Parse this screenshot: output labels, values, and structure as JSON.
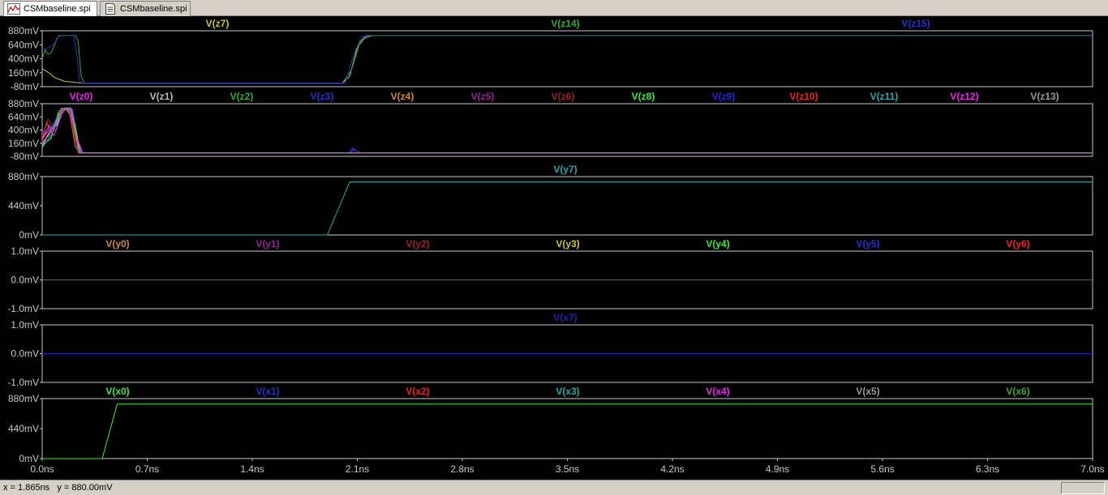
{
  "tabs": [
    {
      "label": "CSMbaseline.spi",
      "icon": "waveform-icon",
      "active": true
    },
    {
      "label": "CSMbaseline.spi",
      "icon": "netlist-document-icon",
      "active": false
    }
  ],
  "status": {
    "x_readout": "x = 1.865ns",
    "y_readout": "y = 880.00mV"
  },
  "colors": {
    "background": "#000000",
    "frame": "#c8c8c8",
    "axis_text": "#c8c8c8"
  },
  "chart_data": [
    {
      "type": "line",
      "y_tick_labels": [
        "880mV",
        "640mV",
        "400mV",
        "160mV",
        "-80mV"
      ],
      "y_tick_values": [
        880,
        640,
        400,
        160,
        -80
      ],
      "ylim": [
        -80,
        880
      ],
      "xlim": [
        0,
        7.0
      ],
      "series": [
        {
          "name": "V(z7)",
          "color": "#c8c832",
          "points": [
            [
              0,
              230
            ],
            [
              0.02,
              200
            ],
            [
              0.05,
              150
            ],
            [
              0.08,
              80
            ],
            [
              0.12,
              40
            ],
            [
              0.15,
              10
            ],
            [
              0.2,
              0
            ],
            [
              0.27,
              -20
            ],
            [
              2.0,
              -20
            ],
            [
              2.05,
              100
            ],
            [
              2.1,
              600
            ],
            [
              2.15,
              760
            ],
            [
              2.2,
              800
            ],
            [
              7.0,
              800
            ]
          ]
        },
        {
          "name": "V(z14)",
          "color": "#33aa33",
          "points": [
            [
              0,
              400
            ],
            [
              0.02,
              550
            ],
            [
              0.04,
              480
            ],
            [
              0.06,
              500
            ],
            [
              0.08,
              620
            ],
            [
              0.1,
              760
            ],
            [
              0.12,
              800
            ],
            [
              0.22,
              800
            ],
            [
              0.24,
              700
            ],
            [
              0.26,
              100
            ],
            [
              0.28,
              -20
            ],
            [
              2.0,
              -20
            ],
            [
              2.06,
              200
            ],
            [
              2.12,
              700
            ],
            [
              2.16,
              800
            ],
            [
              7.0,
              800
            ]
          ]
        },
        {
          "name": "V(z15)",
          "color": "#2233cc",
          "points": [
            [
              0,
              550
            ],
            [
              0.05,
              600
            ],
            [
              0.09,
              680
            ],
            [
              0.11,
              800
            ],
            [
              0.21,
              800
            ],
            [
              0.23,
              500
            ],
            [
              0.25,
              0
            ],
            [
              0.27,
              -20
            ],
            [
              2.02,
              -20
            ],
            [
              2.08,
              500
            ],
            [
              2.13,
              780
            ],
            [
              2.17,
              800
            ],
            [
              7.0,
              800
            ]
          ]
        }
      ]
    },
    {
      "type": "line",
      "y_tick_labels": [
        "880mV",
        "640mV",
        "400mV",
        "160mV",
        "-80mV"
      ],
      "y_tick_values": [
        880,
        640,
        400,
        160,
        -80
      ],
      "ylim": [
        -80,
        880
      ],
      "xlim": [
        0,
        7.0
      ],
      "series": [
        {
          "name": "V(z0)",
          "color": "#ee22ee",
          "points": [
            [
              0,
              200
            ],
            [
              0.04,
              450
            ],
            [
              0.08,
              300
            ],
            [
              0.12,
              650
            ],
            [
              0.16,
              800
            ],
            [
              0.2,
              780
            ],
            [
              0.24,
              200
            ],
            [
              0.27,
              -20
            ],
            [
              7.0,
              -20
            ]
          ]
        },
        {
          "name": "V(z1)",
          "color": "#bbbbbb",
          "points": [
            [
              0,
              100
            ],
            [
              0.05,
              350
            ],
            [
              0.1,
              500
            ],
            [
              0.14,
              800
            ],
            [
              0.19,
              800
            ],
            [
              0.23,
              300
            ],
            [
              0.26,
              -20
            ],
            [
              7.0,
              -20
            ]
          ]
        },
        {
          "name": "V(z2)",
          "color": "#33aa33",
          "points": [
            [
              0,
              300
            ],
            [
              0.03,
              500
            ],
            [
              0.07,
              400
            ],
            [
              0.11,
              750
            ],
            [
              0.17,
              800
            ],
            [
              0.21,
              400
            ],
            [
              0.25,
              -20
            ],
            [
              7.0,
              -20
            ]
          ]
        },
        {
          "name": "V(z3)",
          "color": "#2233cc",
          "points": [
            [
              0,
              150
            ],
            [
              0.06,
              420
            ],
            [
              0.1,
              650
            ],
            [
              0.15,
              800
            ],
            [
              0.2,
              700
            ],
            [
              0.24,
              -20
            ],
            [
              2.04,
              -20
            ],
            [
              2.07,
              60
            ],
            [
              2.1,
              10
            ],
            [
              2.13,
              -20
            ],
            [
              7.0,
              -20
            ]
          ]
        },
        {
          "name": "V(z4)",
          "color": "#cc8833",
          "points": [
            [
              0,
              250
            ],
            [
              0.04,
              380
            ],
            [
              0.09,
              550
            ],
            [
              0.13,
              800
            ],
            [
              0.18,
              760
            ],
            [
              0.22,
              100
            ],
            [
              0.25,
              -20
            ],
            [
              7.0,
              -20
            ]
          ]
        },
        {
          "name": "V(z5)",
          "color": "#992299",
          "points": [
            [
              0,
              180
            ],
            [
              0.05,
              300
            ],
            [
              0.1,
              600
            ],
            [
              0.15,
              800
            ],
            [
              0.21,
              600
            ],
            [
              0.24,
              -20
            ],
            [
              2.05,
              -20
            ],
            [
              2.08,
              40
            ],
            [
              2.12,
              -20
            ],
            [
              7.0,
              -20
            ]
          ]
        },
        {
          "name": "V(z6)",
          "color": "#992222",
          "points": [
            [
              0,
              300
            ],
            [
              0.04,
              600
            ],
            [
              0.08,
              450
            ],
            [
              0.13,
              780
            ],
            [
              0.18,
              800
            ],
            [
              0.22,
              200
            ],
            [
              0.26,
              -20
            ],
            [
              7.0,
              -20
            ]
          ]
        },
        {
          "name": "V(z8)",
          "color": "#33ee33",
          "points": [
            [
              0,
              120
            ],
            [
              0.06,
              250
            ],
            [
              0.11,
              700
            ],
            [
              0.16,
              800
            ],
            [
              0.22,
              500
            ],
            [
              0.25,
              -20
            ],
            [
              7.0,
              -20
            ]
          ]
        },
        {
          "name": "V(z9)",
          "color": "#2222ee",
          "points": [
            [
              0,
              350
            ],
            [
              0.05,
              420
            ],
            [
              0.1,
              550
            ],
            [
              0.14,
              800
            ],
            [
              0.19,
              780
            ],
            [
              0.23,
              150
            ],
            [
              0.26,
              -20
            ],
            [
              2.04,
              -20
            ],
            [
              2.07,
              80
            ],
            [
              2.11,
              -20
            ],
            [
              7.0,
              -20
            ]
          ]
        },
        {
          "name": "V(z10)",
          "color": "#ee2222",
          "points": [
            [
              0,
              200
            ],
            [
              0.03,
              550
            ],
            [
              0.07,
              350
            ],
            [
              0.12,
              700
            ],
            [
              0.17,
              800
            ],
            [
              0.21,
              450
            ],
            [
              0.24,
              -20
            ],
            [
              7.0,
              -20
            ]
          ]
        },
        {
          "name": "V(z11)",
          "color": "#22aaaa",
          "points": [
            [
              0,
              80
            ],
            [
              0.06,
              300
            ],
            [
              0.11,
              600
            ],
            [
              0.15,
              800
            ],
            [
              0.2,
              750
            ],
            [
              0.24,
              50
            ],
            [
              0.27,
              -20
            ],
            [
              7.0,
              -20
            ]
          ]
        },
        {
          "name": "V(z12)",
          "color": "#ee22ee",
          "points": [
            [
              0,
              260
            ],
            [
              0.05,
              480
            ],
            [
              0.09,
              380
            ],
            [
              0.14,
              760
            ],
            [
              0.18,
              800
            ],
            [
              0.23,
              250
            ],
            [
              0.27,
              -20
            ],
            [
              7.0,
              -20
            ]
          ]
        },
        {
          "name": "V(z13)",
          "color": "#999999",
          "points": [
            [
              0,
              140
            ],
            [
              0.04,
              320
            ],
            [
              0.09,
              520
            ],
            [
              0.13,
              780
            ],
            [
              0.19,
              800
            ],
            [
              0.22,
              350
            ],
            [
              0.25,
              -20
            ],
            [
              7.0,
              -20
            ]
          ]
        }
      ]
    },
    {
      "type": "line",
      "y_tick_labels": [
        "880mV",
        "440mV",
        "0mV"
      ],
      "y_tick_values": [
        880,
        440,
        0
      ],
      "ylim": [
        0,
        880
      ],
      "xlim": [
        0,
        7.0
      ],
      "series": [
        {
          "name": "V(y7)",
          "color": "#22aaaa",
          "points": [
            [
              0,
              0
            ],
            [
              1.9,
              0
            ],
            [
              2.05,
              800
            ],
            [
              7.0,
              800
            ]
          ]
        }
      ]
    },
    {
      "type": "line",
      "y_tick_labels": [
        "1.0mV",
        "0.0mV",
        "-1.0mV"
      ],
      "y_tick_values": [
        1,
        0,
        -1
      ],
      "ylim": [
        -1,
        1
      ],
      "xlim": [
        0,
        7.0
      ],
      "series": [
        {
          "name": "V(y0)",
          "color": "#cc8833",
          "points": [
            [
              0,
              0
            ],
            [
              7.0,
              0
            ]
          ]
        },
        {
          "name": "V(y1)",
          "color": "#992299",
          "points": [
            [
              0,
              0
            ],
            [
              7.0,
              0
            ]
          ]
        },
        {
          "name": "V(y2)",
          "color": "#992222",
          "points": [
            [
              0,
              0
            ],
            [
              7.0,
              0
            ]
          ]
        },
        {
          "name": "V(y3)",
          "color": "#c8c832",
          "points": [
            [
              0,
              0
            ],
            [
              7.0,
              0
            ]
          ]
        },
        {
          "name": "V(y4)",
          "color": "#33ee33",
          "points": [
            [
              0,
              0
            ],
            [
              7.0,
              0
            ]
          ]
        },
        {
          "name": "V(y5)",
          "color": "#2233cc",
          "points": [
            [
              0,
              0
            ],
            [
              7.0,
              0
            ]
          ]
        },
        {
          "name": "V(y6)",
          "color": "#ee2222",
          "points": [
            [
              0,
              0
            ],
            [
              7.0,
              0
            ]
          ]
        }
      ]
    },
    {
      "type": "line",
      "y_tick_labels": [
        "1.0mV",
        "0.0mV",
        "-1.0mV"
      ],
      "y_tick_values": [
        1,
        0,
        -1
      ],
      "ylim": [
        -1,
        1
      ],
      "xlim": [
        0,
        7.0
      ],
      "series": [
        {
          "name": "V(x7)",
          "color": "#2222aa",
          "points": [
            [
              0,
              0
            ],
            [
              7.0,
              0
            ]
          ]
        }
      ]
    },
    {
      "type": "line",
      "y_tick_labels": [
        "880mV",
        "440mV",
        "0mV"
      ],
      "y_tick_values": [
        880,
        440,
        0
      ],
      "ylim": [
        0,
        880
      ],
      "xlim": [
        0,
        7.0
      ],
      "x_tick_labels": [
        "0.0ns",
        "0.7ns",
        "1.4ns",
        "2.1ns",
        "2.8ns",
        "3.5ns",
        "4.2ns",
        "4.9ns",
        "5.6ns",
        "6.3ns",
        "7.0ns"
      ],
      "x_tick_values": [
        0,
        0.7,
        1.4,
        2.1,
        2.8,
        3.5,
        4.2,
        4.9,
        5.6,
        6.3,
        7.0
      ],
      "series": [
        {
          "name": "V(x0)",
          "color": "#33ee33",
          "points": [
            [
              0,
              0
            ],
            [
              0.4,
              0
            ],
            [
              0.5,
              800
            ],
            [
              7.0,
              800
            ]
          ]
        },
        {
          "name": "V(x1)",
          "color": "#2233cc",
          "points": []
        },
        {
          "name": "V(x2)",
          "color": "#ee2222",
          "points": []
        },
        {
          "name": "V(x3)",
          "color": "#22aaaa",
          "points": []
        },
        {
          "name": "V(x4)",
          "color": "#ee22ee",
          "points": []
        },
        {
          "name": "V(x5)",
          "color": "#999999",
          "points": []
        },
        {
          "name": "V(x6)",
          "color": "#33aa33",
          "points": []
        }
      ]
    }
  ]
}
